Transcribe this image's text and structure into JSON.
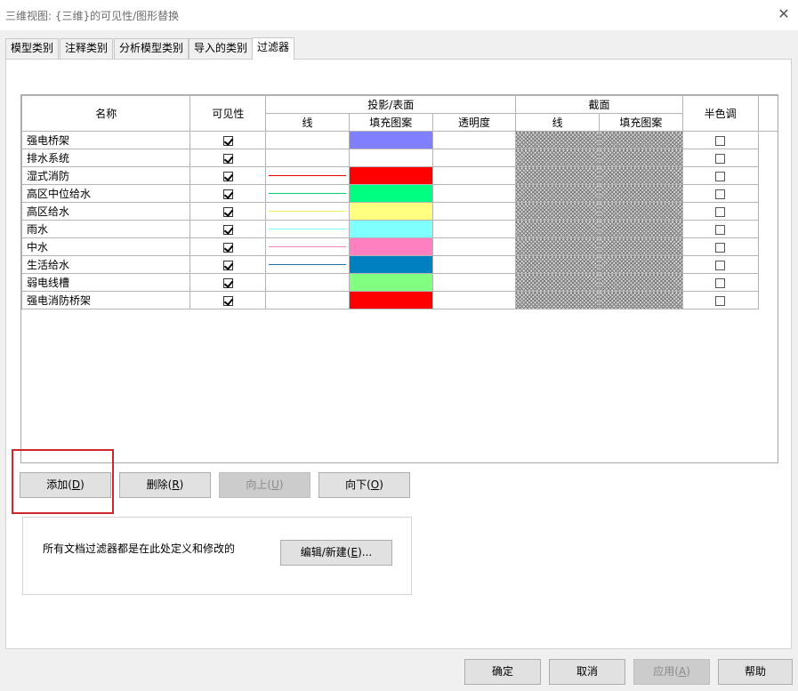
{
  "window": {
    "title": "三维视图: {三维}的可见性/图形替换"
  },
  "tabs": [
    {
      "label": "模型类别"
    },
    {
      "label": "注释类别"
    },
    {
      "label": "分析模型类别"
    },
    {
      "label": "导入的类别"
    },
    {
      "label": "过滤器"
    }
  ],
  "active_tab": "过滤器",
  "grid": {
    "headers": {
      "name": "名称",
      "visibility": "可见性",
      "projection": "投影/表面",
      "cut": "截面",
      "halftone": "半色调",
      "proj_line": "线",
      "proj_fill": "填充图案",
      "proj_transparency": "透明度",
      "cut_line": "线",
      "cut_fill": "填充图案"
    },
    "rows": [
      {
        "name": "强电桥架",
        "visible": true,
        "line_color": "",
        "fill_color": "#8080ff",
        "halftone": false
      },
      {
        "name": "排水系统",
        "visible": true,
        "line_color": "",
        "fill_color": "",
        "halftone": false
      },
      {
        "name": "湿式消防",
        "visible": true,
        "line_color": "#e00000",
        "fill_color": "#ff0000",
        "halftone": false
      },
      {
        "name": "高区中位给水",
        "visible": true,
        "line_color": "#00d070",
        "fill_color": "#00ff80",
        "halftone": false
      },
      {
        "name": "高区给水",
        "visible": true,
        "line_color": "#f0f060",
        "fill_color": "#ffff80",
        "halftone": false
      },
      {
        "name": "雨水",
        "visible": true,
        "line_color": "#80f8f8",
        "fill_color": "#80ffff",
        "halftone": false
      },
      {
        "name": "中水",
        "visible": true,
        "line_color": "#f080c0",
        "fill_color": "#ff80c0",
        "halftone": false
      },
      {
        "name": "生活给水",
        "visible": true,
        "line_color": "#2070b0",
        "fill_color": "#0080c0",
        "halftone": false
      },
      {
        "name": "弱电线槽",
        "visible": true,
        "line_color": "",
        "fill_color": "#80ff80",
        "halftone": false
      },
      {
        "name": "强电消防桥架",
        "visible": true,
        "line_color": "",
        "fill_color": "#ff0000",
        "halftone": false
      }
    ]
  },
  "buttons": {
    "add": {
      "text": "添加(",
      "key": "D",
      "tail": ")"
    },
    "delete": {
      "text": "删除(",
      "key": "R",
      "tail": ")"
    },
    "up": {
      "text": "向上(",
      "key": "U",
      "tail": ")"
    },
    "down": {
      "text": "向下(",
      "key": "O",
      "tail": ")"
    },
    "edit": {
      "text": "编辑/新建(",
      "key": "E",
      "tail": ")..."
    },
    "ok": "确定",
    "cancel": "取消",
    "apply": {
      "text": "应用(",
      "key": "A",
      "tail": ")"
    },
    "help": "帮助"
  },
  "info_text": "所有文档过滤器都是在此处定义和修改的",
  "colors": {
    "highlight": "#d0262d",
    "hatch": "#7a7a7a"
  }
}
